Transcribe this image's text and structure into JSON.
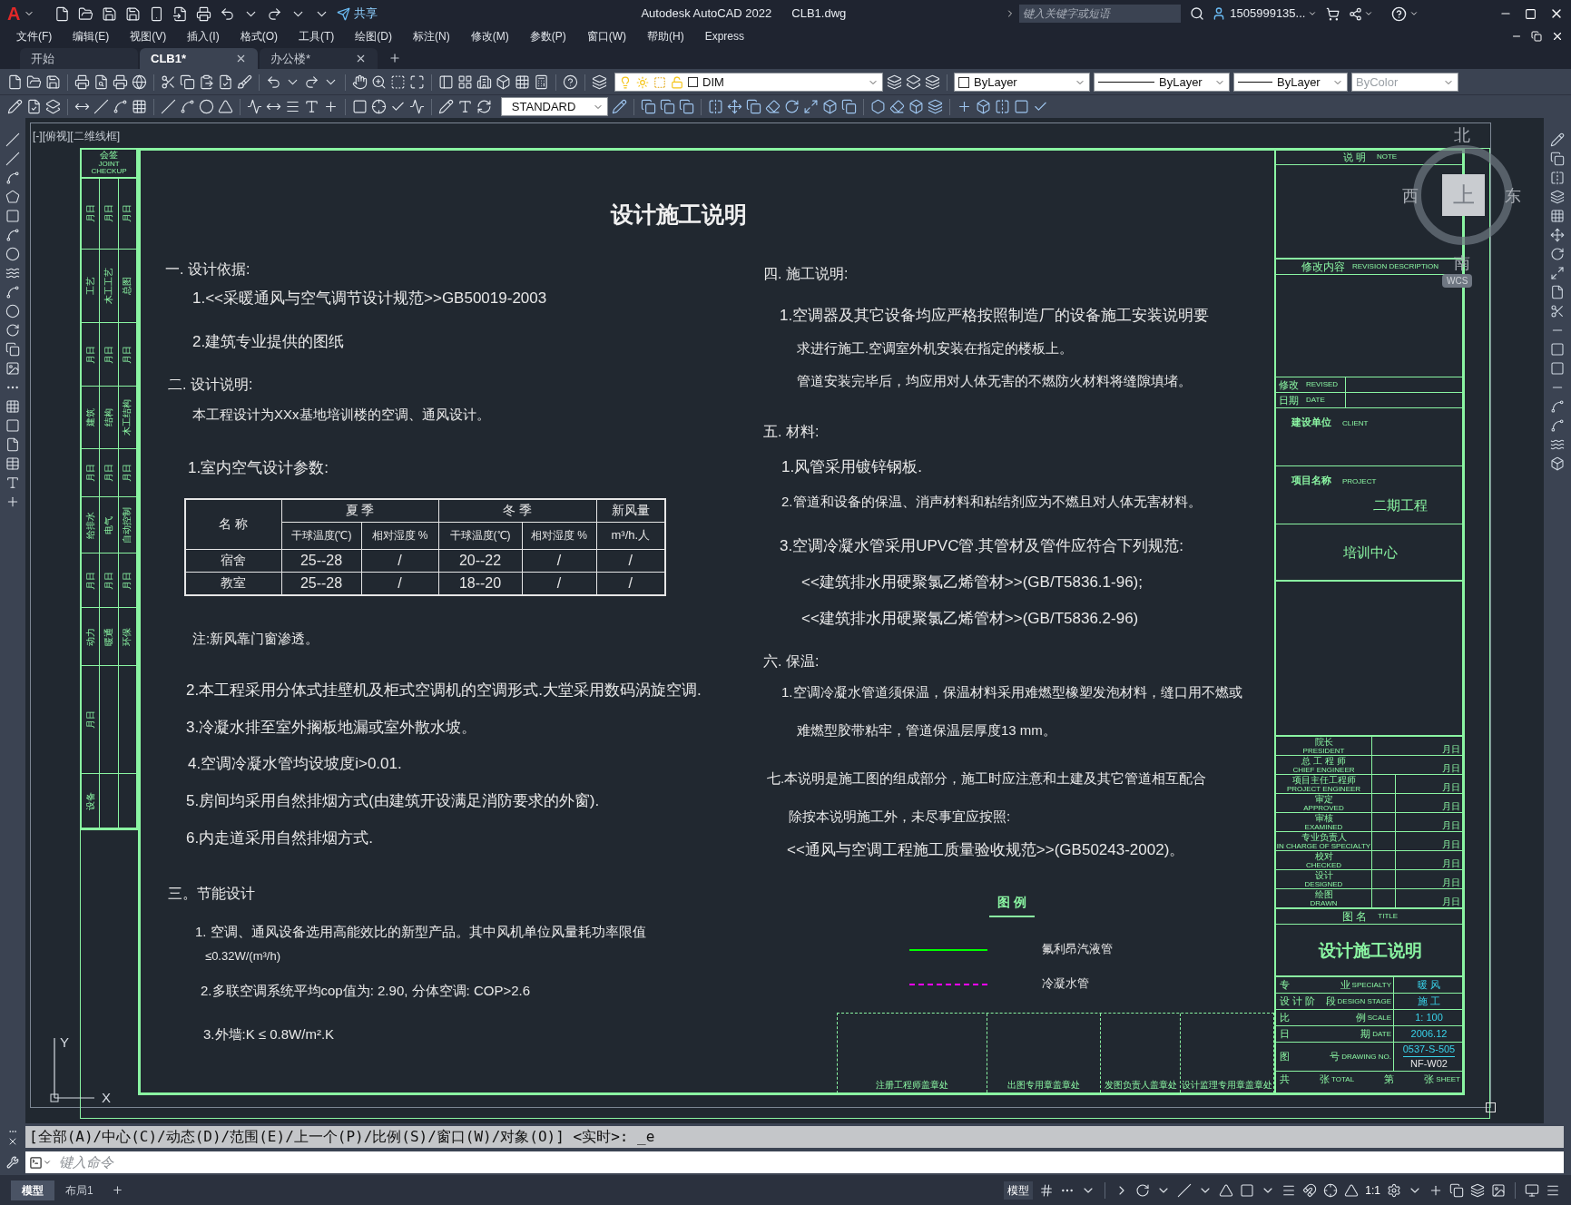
{
  "title_bar": {
    "logo": "A",
    "share": "共享",
    "app_title": "Autodesk AutoCAD 2022",
    "file_name": "CLB1.dwg",
    "search": {
      "placeholder": "键入关键字或短语"
    },
    "user": "1505999135..."
  },
  "menu": [
    "文件(F)",
    "编辑(E)",
    "视图(V)",
    "插入(I)",
    "格式(O)",
    "工具(T)",
    "绘图(D)",
    "标注(N)",
    "修改(M)",
    "参数(P)",
    "窗口(W)",
    "帮助(H)",
    "Express"
  ],
  "file_tabs": [
    {
      "label": "开始",
      "selected": false,
      "closable": false
    },
    {
      "label": "CLB1*",
      "selected": true,
      "closable": true
    },
    {
      "label": "办公楼*",
      "selected": false,
      "closable": true
    }
  ],
  "properties": {
    "layer": "DIM",
    "text_style": "STANDARD",
    "color_setting": "ByLayer",
    "linetype": "ByLayer",
    "lineweight": "ByLayer",
    "plot_style": {
      "value": "ByColor",
      "disabled": true
    }
  },
  "viewport_label": "[-][俯视][二维线框]",
  "view_cube": {
    "north": "北",
    "west": "西",
    "east": "东",
    "south": "南",
    "face": "上",
    "ucs": "WCS"
  },
  "ucs_icon": {
    "y": "Y",
    "x": "X"
  },
  "drawing": {
    "title": "设计施工说明",
    "left_column": [
      {
        "kind": "heading",
        "text": "一. 设计依据:"
      },
      {
        "kind": "large",
        "text": "1.<<采暖通风与空气调节设计规范>>GB50019-2003"
      },
      {
        "kind": "large",
        "text": "2.建筑专业提供的图纸"
      },
      {
        "kind": "heading",
        "text": "二. 设计说明:"
      },
      {
        "kind": "text",
        "text": "本工程设计为XXx基地培训楼的空调、通风设计。"
      },
      {
        "kind": "large",
        "text": "1.室内空气设计参数:"
      },
      {
        "kind": "table",
        "name_header": "名 称",
        "groups": [
          {
            "label": "夏 季",
            "columns": [
              "干球温度(℃)",
              "相对湿度 %"
            ]
          },
          {
            "label": "冬 季",
            "columns": [
              "干球温度(℃)",
              "相对湿度 %"
            ]
          }
        ],
        "fresh_air_header": "新风量",
        "fresh_air_unit": "m³/h.人",
        "rows": [
          {
            "name": "宿舍",
            "cells": [
              "25--28",
              "/",
              "20--22",
              "/",
              "/"
            ]
          },
          {
            "name": "教室",
            "cells": [
              "25--28",
              "/",
              "18--20",
              "/",
              "/"
            ]
          }
        ]
      },
      {
        "kind": "text",
        "text": "注:新风靠门窗渗透。"
      },
      {
        "kind": "large",
        "text": "2.本工程采用分体式挂壁机及柜式空调机的空调形式.大堂采用数码涡旋空调."
      },
      {
        "kind": "large",
        "text": "3.冷凝水排至室外搁板地漏或室外散水坡。"
      },
      {
        "kind": "large",
        "text": "4.空调冷凝水管均设坡度i>0.01."
      },
      {
        "kind": "large",
        "text": "5.房间均采用自然排烟方式(由建筑开设满足消防要求的外窗)."
      },
      {
        "kind": "large",
        "text": "6.内走道采用自然排烟方式."
      },
      {
        "kind": "heading",
        "text": "三。节能设计"
      },
      {
        "kind": "text",
        "text": "1. 空调、通风设备选用高能效比的新型产品。其中风机单位风量耗功率限值"
      },
      {
        "kind": "small",
        "text": "≤0.32W/(m³/h)"
      },
      {
        "kind": "text",
        "text": "2.多联空调系统平均cop值为: 2.90, 分体空调: COP>2.6"
      },
      {
        "kind": "text",
        "text": "3.外墙:K ≤ 0.8W/m².K"
      }
    ],
    "right_column": [
      {
        "kind": "heading",
        "text": "四. 施工说明:"
      },
      {
        "kind": "large",
        "text": "1.空调器及其它设备均应严格按照制造厂的设备施工安装说明要"
      },
      {
        "kind": "text",
        "text": "求进行施工.空调室外机安装在指定的楼板上。"
      },
      {
        "kind": "text",
        "text": "管道安装完毕后，均应用对人体无害的不燃防火材料将缝隙填堵。"
      },
      {
        "kind": "heading",
        "text": "五. 材料:"
      },
      {
        "kind": "large",
        "text": "1.风管采用镀锌钢板."
      },
      {
        "kind": "text",
        "text": "2.管道和设备的保温、消声材料和粘结剂应为不燃且对人体无害材料。"
      },
      {
        "kind": "large",
        "text": "3.空调冷凝水管采用UPVC管.其管材及管件应符合下列规范:"
      },
      {
        "kind": "large",
        "text": "<<建筑排水用硬聚氯乙烯管材>>(GB/T5836.1-96);"
      },
      {
        "kind": "large",
        "text": "<<建筑排水用硬聚氯乙烯管材>>(GB/T5836.2-96)"
      },
      {
        "kind": "heading",
        "text": "六. 保温:"
      },
      {
        "kind": "text",
        "text": "1.空调冷凝水管道须保温，保温材料采用难燃型橡塑发泡材料，缝口用不燃或"
      },
      {
        "kind": "text",
        "text": "难燃型胶带粘牢，管道保温层厚度13 mm。"
      },
      {
        "kind": "text",
        "text": "七.本说明是施工图的组成部分，施工时应注意和土建及其它管道相互配合"
      },
      {
        "kind": "text",
        "text": "除按本说明施工外，未尽事宜应按照:"
      },
      {
        "kind": "large",
        "text": "<<通风与空调工程施工质量验收规范>>(GB50243-2002)。"
      }
    ],
    "legend": {
      "title": "图 例",
      "items": [
        {
          "kind": "solid",
          "color": "#00ff00",
          "label": "氟利昂汽液管"
        },
        {
          "kind": "dash-dot",
          "color": "#ff00ff",
          "label": "冷凝水管"
        }
      ]
    },
    "stamp_boxes": [
      "注册工程师盖章处",
      "出图专用章盖章处",
      "发图负责人盖章处",
      "设计监理专用章盖章处"
    ],
    "joint_checkup": {
      "title": "会签",
      "subtitle": "JOINT CHECKUP",
      "blocks": [
        {
          "cells": [
            "月日",
            "月日",
            "月日"
          ]
        },
        {
          "cells": [
            "工艺",
            "木工工艺",
            "总图"
          ]
        },
        {
          "cells": [
            "月日",
            "月日",
            "月日"
          ]
        },
        {
          "cells": [
            "建筑",
            "结构",
            "木工结构"
          ]
        },
        {
          "cells": [
            "月日",
            "月日",
            "月日"
          ]
        },
        {
          "cells": [
            "给排水",
            "电气",
            "自动控制"
          ]
        },
        {
          "cells": [
            "月日",
            "月日",
            "月日"
          ]
        },
        {
          "cells": [
            "动力",
            "暖通",
            "环保"
          ]
        },
        {
          "cells": [
            "月日"
          ]
        },
        {
          "cells": [
            "设备"
          ]
        }
      ]
    },
    "title_block": {
      "note": {
        "label": "说 明",
        "label_en": "NOTE"
      },
      "revision": {
        "label": "修改内容",
        "label_en": "REVISION DESCRIPTION"
      },
      "revised": {
        "label": "修改",
        "label_en": "REVISED"
      },
      "revised_date": {
        "label": "日期",
        "label_en": "DATE"
      },
      "client": {
        "label": "建设单位",
        "label_en": "CLIENT"
      },
      "project": {
        "label": "项目名称",
        "label_en": "PROJECT",
        "value": "二期工程"
      },
      "project_name": "培训中心",
      "signatures": [
        {
          "label": "院长",
          "label_en": "PRESIDENT",
          "date": "月日"
        },
        {
          "label": "总 工 程 师",
          "label_en": "CHIEF ENGINEER",
          "date": "月日"
        },
        {
          "label": "项目主任工程师",
          "label_en": "PROJECT ENGINEER",
          "date": "月日"
        },
        {
          "label": "审定",
          "label_en": "APPROVED",
          "date": "月日"
        },
        {
          "label": "审核",
          "label_en": "EXAMINED",
          "date": "月日"
        },
        {
          "label": "专业负责人",
          "label_en": "IN CHARGE OF SPECIALTY",
          "date": "月日"
        },
        {
          "label": "校对",
          "label_en": "CHECKED",
          "date": "月日"
        },
        {
          "label": "设计",
          "label_en": "DESIGNED",
          "date": "月日"
        },
        {
          "label": "绘图",
          "label_en": "DRAWN",
          "date": "月日"
        }
      ],
      "drawing_title": {
        "label": "图 名",
        "label_en": "TITLE",
        "value": "设计施工说明"
      },
      "info": [
        {
          "label": "专",
          "label2": "业",
          "label_en": "SPECIALTY",
          "value": "暖 风"
        },
        {
          "label": "设 计 阶",
          "label2": "段",
          "label_en": "DESIGN STAGE",
          "value": "施 工"
        },
        {
          "label": "比",
          "label2": "例",
          "label_en": "SCALE",
          "value": "1: 100"
        },
        {
          "label": "日",
          "label2": "期",
          "label_en": "DATE",
          "value": "2006.12"
        },
        {
          "label": "图",
          "label2": "号",
          "label_en": "DRAWING NO.",
          "value": "0537-S-505",
          "value2": "NF-W02"
        }
      ],
      "sheet": {
        "total": "共",
        "total_unit": "张",
        "total_en": "TOTAL",
        "sheet": "第",
        "sheet_unit": "张",
        "sheet_en": "SHEET"
      }
    }
  },
  "command_line": {
    "history": "[全部(A)/中心(C)/动态(D)/范围(E)/上一个(P)/比例(S)/窗口(W)/对象(O)] <实时>: _e",
    "placeholder": "键入命令"
  },
  "layout_tabs": [
    {
      "label": "模型",
      "selected": true
    },
    {
      "label": "布局1",
      "selected": false
    }
  ],
  "status_bar": {
    "model": "模型",
    "scale": "1:1"
  }
}
